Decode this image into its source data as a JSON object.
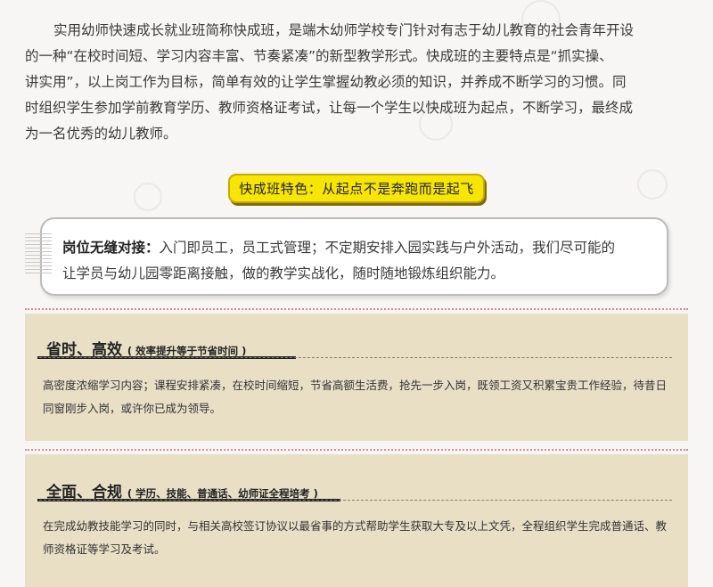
{
  "intro": {
    "lines": [
      "实用幼师快速成长就业班简称快成班，是端木幼师学校专门针对有志于幼儿教育的社会青年开设",
      "的一种“在校时间短、学习内容丰富、节奏紧凑”的新型教学形式。快成班的主要特点是“抓实操、",
      "讲实用”，以上岗工作为目标，简单有效的让学生掌握幼教必须的知识，并养成不断学习的习惯。同",
      "时组织学生参加学前教育学历、教师资格证考试，让每一个学生以快成班为起点，不断学习，最终成",
      "为一名优秀的幼儿教师。"
    ]
  },
  "badge": {
    "text": "快成班特色：从起点不是奔跑而是起飞",
    "bg_color": "#f6e600"
  },
  "feature": {
    "heading": "岗位无缝对接：",
    "line1": "入门即员工，员工式管理；不定期安排入园实践与户外活动，我们尽可能的",
    "line2": "让学员与幼儿园零距离接触，做的教学实战化，随时随地锻炼组织能力。"
  },
  "panels": [
    {
      "title": "省时、高效",
      "subtitle": "( 效率提升等于节省时间 )",
      "line1": "高密度浓缩学习内容；课程安排紧凑，在校时间缩短，节省高额生活费，抢先一步入岗，既领工资又积累宝贵工作经验，待昔日",
      "line2": "同窗刚步入岗，或许你已成为领导。"
    },
    {
      "title": "全面、合规",
      "subtitle": "( 学历、技能、普通话、幼师证全程培考 )",
      "line1": "在完成幼教技能学习的同时，与相关高校签订协议以最省事的方式帮助学生获取大专及以上文凭，全程组织学生完成普通话、教",
      "line2": "师资格证等学习及考试。"
    }
  ],
  "colors": {
    "panel_bg": "#e8dfc5",
    "separator": "#d98c8c"
  }
}
